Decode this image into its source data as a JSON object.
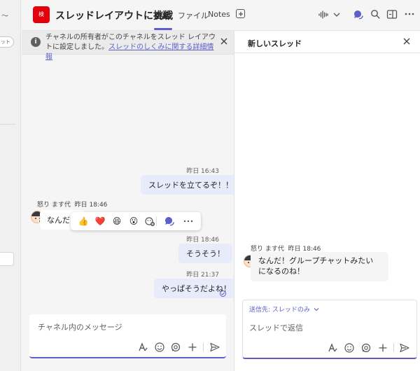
{
  "left_rail": {
    "chevron": "〜",
    "pill_label": "ット"
  },
  "header": {
    "team_avatar_text": "検",
    "title": "スレッドレイアウトに挑戦",
    "tabs": [
      {
        "label": "会話"
      },
      {
        "label": "ファイル"
      },
      {
        "label": "Notes"
      }
    ]
  },
  "banner": {
    "text": "チャネルの所有者がこのチャネルをスレッド レイアウトに設定しました。",
    "link": "スレッドのしくみに関する詳細情報"
  },
  "messages": {
    "m1": {
      "time": "昨日 16:43",
      "text": "スレッドを立てるぞ！！"
    },
    "m2": {
      "sender": "怒り ます代",
      "time": "昨日 18:46",
      "text": "なんだ！"
    },
    "m3": {
      "time": "昨日 18:46",
      "text": "そうそう！"
    },
    "m4": {
      "time": "昨日 21:37",
      "text": "やっぱそうだよね！"
    }
  },
  "reactions": [
    "👍",
    "❤️",
    "😆",
    "😮",
    "more-reactions",
    "reply-thread",
    "more-options"
  ],
  "composer": {
    "placeholder": "チャネル内のメッセージ"
  },
  "thread_pane": {
    "title": "新しいスレッド",
    "message": {
      "sender": "怒り ます代",
      "time": "昨日 18:46",
      "text": "なんだ！グループチャットみたいになるのね！"
    },
    "send_to": "送信先: スレッドのみ",
    "reply_placeholder": "スレッドで返信"
  },
  "colors": {
    "accent": "#5b5fc7",
    "team_avatar": "#e3000b",
    "bubble_me": "#e8ebfa",
    "presence": "#13a10e"
  }
}
